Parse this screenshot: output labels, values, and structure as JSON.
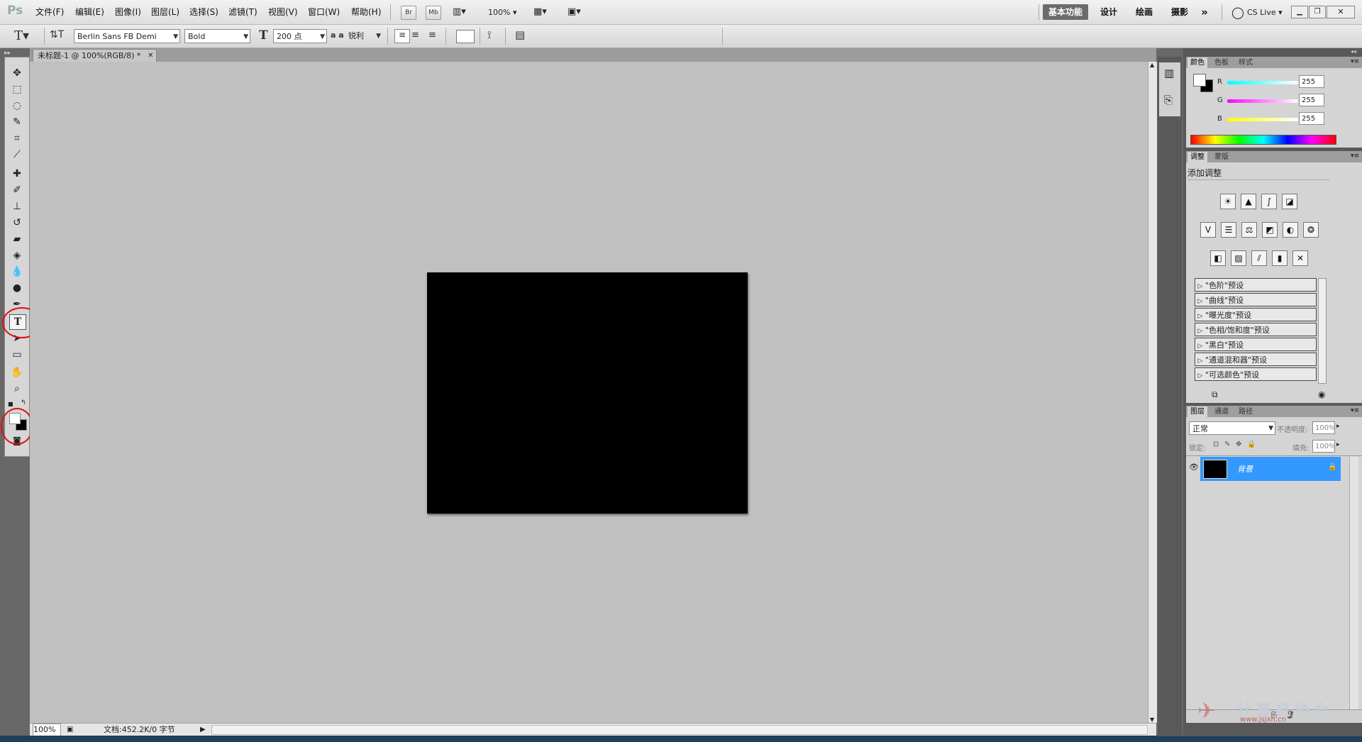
{
  "app": {
    "logo": "Ps"
  },
  "menu": [
    "文件(F)",
    "编辑(E)",
    "图像(I)",
    "图层(L)",
    "选择(S)",
    "滤镜(T)",
    "视图(V)",
    "窗口(W)",
    "帮助(H)"
  ],
  "menubar_buttons": {
    "bridge": "Br",
    "minibridge": "Mb",
    "zoom": "100%"
  },
  "workspaces": [
    "基本功能",
    "设计",
    "绘画",
    "摄影"
  ],
  "workspace_more": "»",
  "cs_live": "CS Live",
  "options": {
    "font_family": "Berlin Sans FB Demi",
    "font_style": "Bold",
    "font_size": "200 点",
    "aa_label": "a a",
    "antialias": "锐利"
  },
  "document": {
    "tab_title": "未标题-1 @ 100%(RGB/8) *",
    "zoom": "100%",
    "doc_info": "文档:452.2K/0 字节"
  },
  "color_panel": {
    "tabs": [
      "颜色",
      "色板",
      "样式"
    ],
    "channels": [
      {
        "label": "R",
        "value": "255"
      },
      {
        "label": "G",
        "value": "255"
      },
      {
        "label": "B",
        "value": "255"
      }
    ]
  },
  "adjust_panel": {
    "tabs": [
      "调整",
      "蒙版"
    ],
    "title": "添加调整",
    "presets": [
      "\"色阶\"预设",
      "\"曲线\"预设",
      "\"曝光度\"预设",
      "\"色相/饱和度\"预设",
      "\"黑白\"预设",
      "\"通道混和器\"预设",
      "\"可选颜色\"预设"
    ]
  },
  "layers_panel": {
    "tabs": [
      "图层",
      "通道",
      "路径"
    ],
    "blend_mode": "正常",
    "opacity_label": "不透明度:",
    "opacity": "100%",
    "lock_label": "锁定:",
    "fill_label": "填充:",
    "fill": "100%",
    "layer_name": "背景"
  },
  "watermark": {
    "text": "计算机协会",
    "url": "www.jsjxh.cn"
  },
  "colors": {
    "accent_layer": "#3399ff",
    "annotation": "#e01010"
  }
}
